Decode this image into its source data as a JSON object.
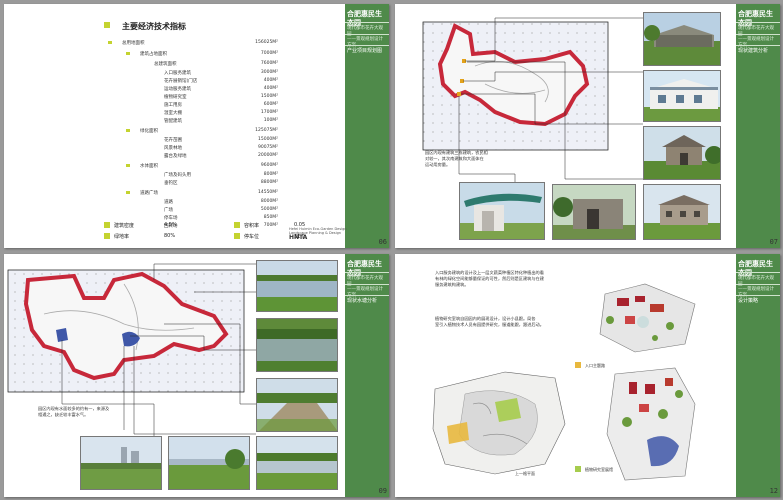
{
  "brand": {
    "name": "合肥惠民生态园",
    "subtitle_lines": [
      "现代都市花卉大观园",
      "——景观规划设计方案"
    ],
    "sections": [
      "产业项目规划图",
      "现状建筑分析",
      "现状水塘分析",
      "设计策略"
    ]
  },
  "page_numbers": [
    "06",
    "07",
    "09",
    "12"
  ],
  "footer": {
    "title": "HNTA",
    "lines": [
      "Hefei Huimin Eco-Garden Design",
      "Landscape Planning & Design"
    ]
  },
  "econ": {
    "title": "主要经济技术指标",
    "rows": [
      {
        "label": "总用地面积",
        "value": "156025M²"
      },
      {
        "label": "建筑占地面积",
        "value": "7000M²"
      },
      {
        "label": "总建筑面积",
        "value": "7600M²"
      },
      {
        "label": "入口服务建筑",
        "value": "3000M²"
      },
      {
        "label": "花卉展销馆(门店",
        "value": "400M²"
      },
      {
        "label": "运动服务建筑",
        "value": "400M²"
      },
      {
        "label": "植物研究室",
        "value": "1500M²"
      },
      {
        "label": "施工用房",
        "value": "600M²"
      },
      {
        "label": "温室大棚",
        "value": "1700M²"
      },
      {
        "label": "管配建筑",
        "value": "100M²"
      },
      {
        "label": "绿化面积",
        "value": "125075M²"
      },
      {
        "label": "花卉苗圃",
        "value": "15000M²"
      },
      {
        "label": "风景林地",
        "value": "90075M²"
      },
      {
        "label": "露台及绿地",
        "value": "20000M²"
      },
      {
        "label": "水体面积",
        "value": "9600M²"
      },
      {
        "label": "广场及码头用",
        "value": "800M²"
      },
      {
        "label": "垂钓区",
        "value": "8800M²"
      },
      {
        "label": "道路广场",
        "value": "14550M²"
      },
      {
        "label": "道路",
        "value": "8000M²"
      },
      {
        "label": "广场",
        "value": "5000M²"
      },
      {
        "label": "停车场",
        "value": "850M²"
      },
      {
        "label": "回转场",
        "value": "700M²"
      }
    ],
    "stats": [
      {
        "label": "建筑密度",
        "value": "4.5%"
      },
      {
        "label": "容积率",
        "value": "0.05"
      },
      {
        "label": "绿地率",
        "value": "80%"
      },
      {
        "label": "停车位",
        "value": "31个"
      }
    ]
  },
  "captions": {
    "buildings": [
      "园区内现有建筑三栋建筑，农民相",
      "对较一，其次南建筑和大面体在",
      "运动用房量。"
    ],
    "ponds": [
      "园区内现有水面较多的约有一，来源及",
      "相通之，缺乏较丰富水气。"
    ],
    "plan": [
      "入口服务建筑的设计及上一层文蔬菜种植区特化种植出的看",
      "有林的绿化空间能够量保证的可性，然后则是区建筑与在建",
      "服务建筑构建筑。"
    ],
    "plant": [
      "植物研究室筑自园园内的展现设计，设计小县跟。局各",
      "室引入植物技术人员有园提供研究，服道能跟，跟进后动。"
    ],
    "legend_entrance": "入口主题路",
    "legend_plant": "植物研究室展馆",
    "plan_label": "上一格平面"
  },
  "colors": {
    "band": "#4f8a4a",
    "accent": "#c4d330",
    "water": "#3f57a8",
    "site": "#c7283a"
  }
}
